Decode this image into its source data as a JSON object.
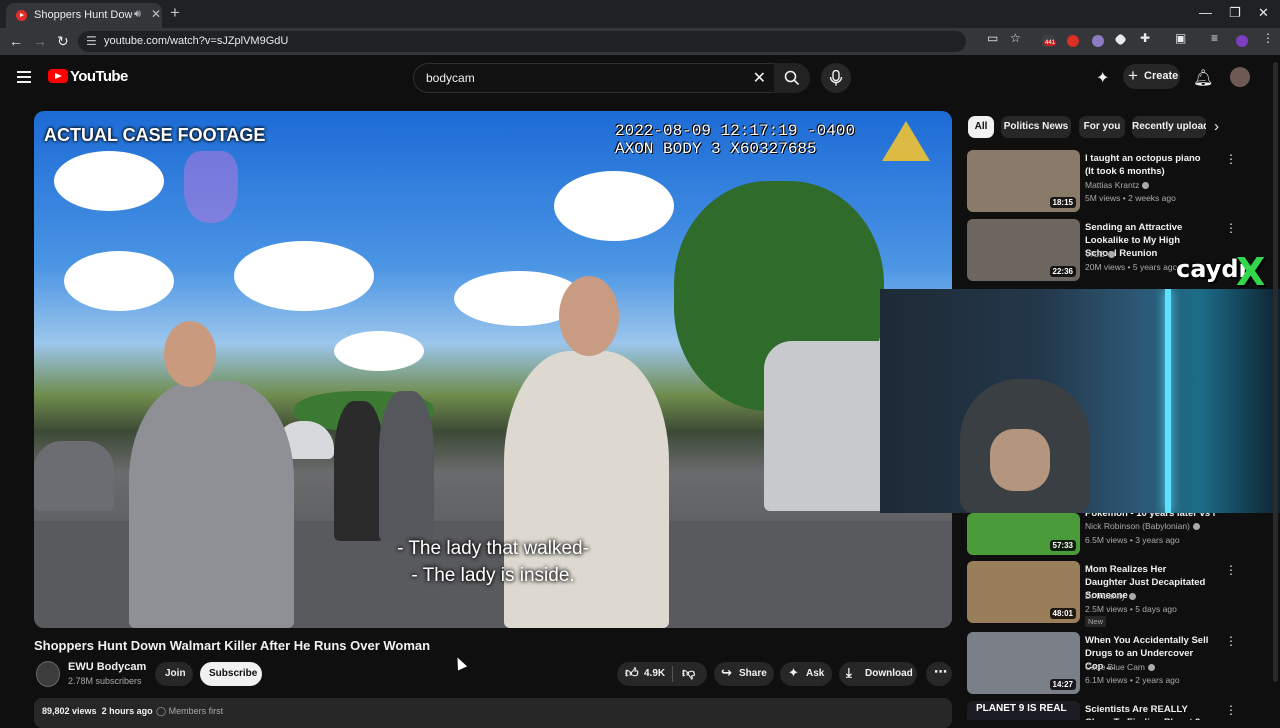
{
  "browser": {
    "tab_title": "Shoppers Hunt Down Walmart Killer After He Runs Over Woman",
    "url": "youtube.com/watch?v=sJZplVM9GdU",
    "extension_badge": "441",
    "icons": [
      "back-icon",
      "forward-icon",
      "reload-icon",
      "site-info-icon",
      "cast-icon",
      "bookmark-star-icon",
      "extensions-icon",
      "profile-icon",
      "menu-icon"
    ]
  },
  "masthead": {
    "logo_text": "YouTube",
    "search_value": "bodycam",
    "create_label": "Create"
  },
  "video": {
    "overlay_label": "ACTUAL CASE FOOTAGE",
    "stamp_line1": "2022-08-09 12:17:19 -0400",
    "stamp_line2": "AXON BODY 3 X60327685",
    "subtitle_line1": "- The lady that walked-",
    "subtitle_line2": "- The lady is inside."
  },
  "info": {
    "title": "Shoppers Hunt Down Walmart Killer After He Runs Over Woman",
    "channel_name": "EWU Bodycam",
    "channel_subs": "2.78M subscribers",
    "join_label": "Join",
    "subscribe_label": "Subscribe",
    "likes": "4.9K",
    "share_label": "Share",
    "ask_label": "Ask",
    "download_label": "Download",
    "views": "89,802 views",
    "age": "2 hours ago",
    "members": "Members first"
  },
  "chips": [
    "All",
    "Politics News",
    "For you",
    "Recently uploaded"
  ],
  "recommendations": [
    {
      "title": "I taught an octopus piano (It took 6 months)",
      "channel": "Mattias Krantz",
      "verified": true,
      "meta": "5M views • 2 weeks ago",
      "duration": "18:15",
      "badge": "",
      "thumb": "#8a7a6a"
    },
    {
      "title": "Sending an Attractive Lookalike to My High School Reunion",
      "channel": "VICE",
      "verified": true,
      "meta": "20M views • 5 years ago",
      "duration": "22:36",
      "badge": "",
      "thumb": "#6d655f"
    },
    {
      "title": "Pokémon - 10 years later vs N...",
      "channel": "Nick Robinson (Babylonian)",
      "verified": true,
      "meta": "6.5M views • 3 years ago",
      "duration": "57:33",
      "badge": "",
      "thumb": "#4a9b3a"
    },
    {
      "title": "Mom Realizes Her Daughter Just Decapitated Someone",
      "channel": "Dr Insanity",
      "verified": true,
      "meta": "2.5M views • 5 days ago",
      "duration": "48:01",
      "badge": "New",
      "thumb": "#9a7d5a"
    },
    {
      "title": "When You Accidentally Sell Drugs to an Undercover Cop ...",
      "channel": "Code Blue Cam",
      "verified": true,
      "meta": "6.1M views • 2 years ago",
      "duration": "14:27",
      "badge": "",
      "thumb": "#7a7f88"
    },
    {
      "title": "Scientists Are REALLY Close To Finding Planet 9",
      "channel": "",
      "verified": false,
      "meta": "",
      "duration": "",
      "badge": "",
      "thumb": "#1c1c24",
      "thumb_text": "PLANET 9 IS REAL"
    }
  ],
  "streamer_overlay": {
    "brand": "caydr",
    "brand_mark": "X"
  }
}
